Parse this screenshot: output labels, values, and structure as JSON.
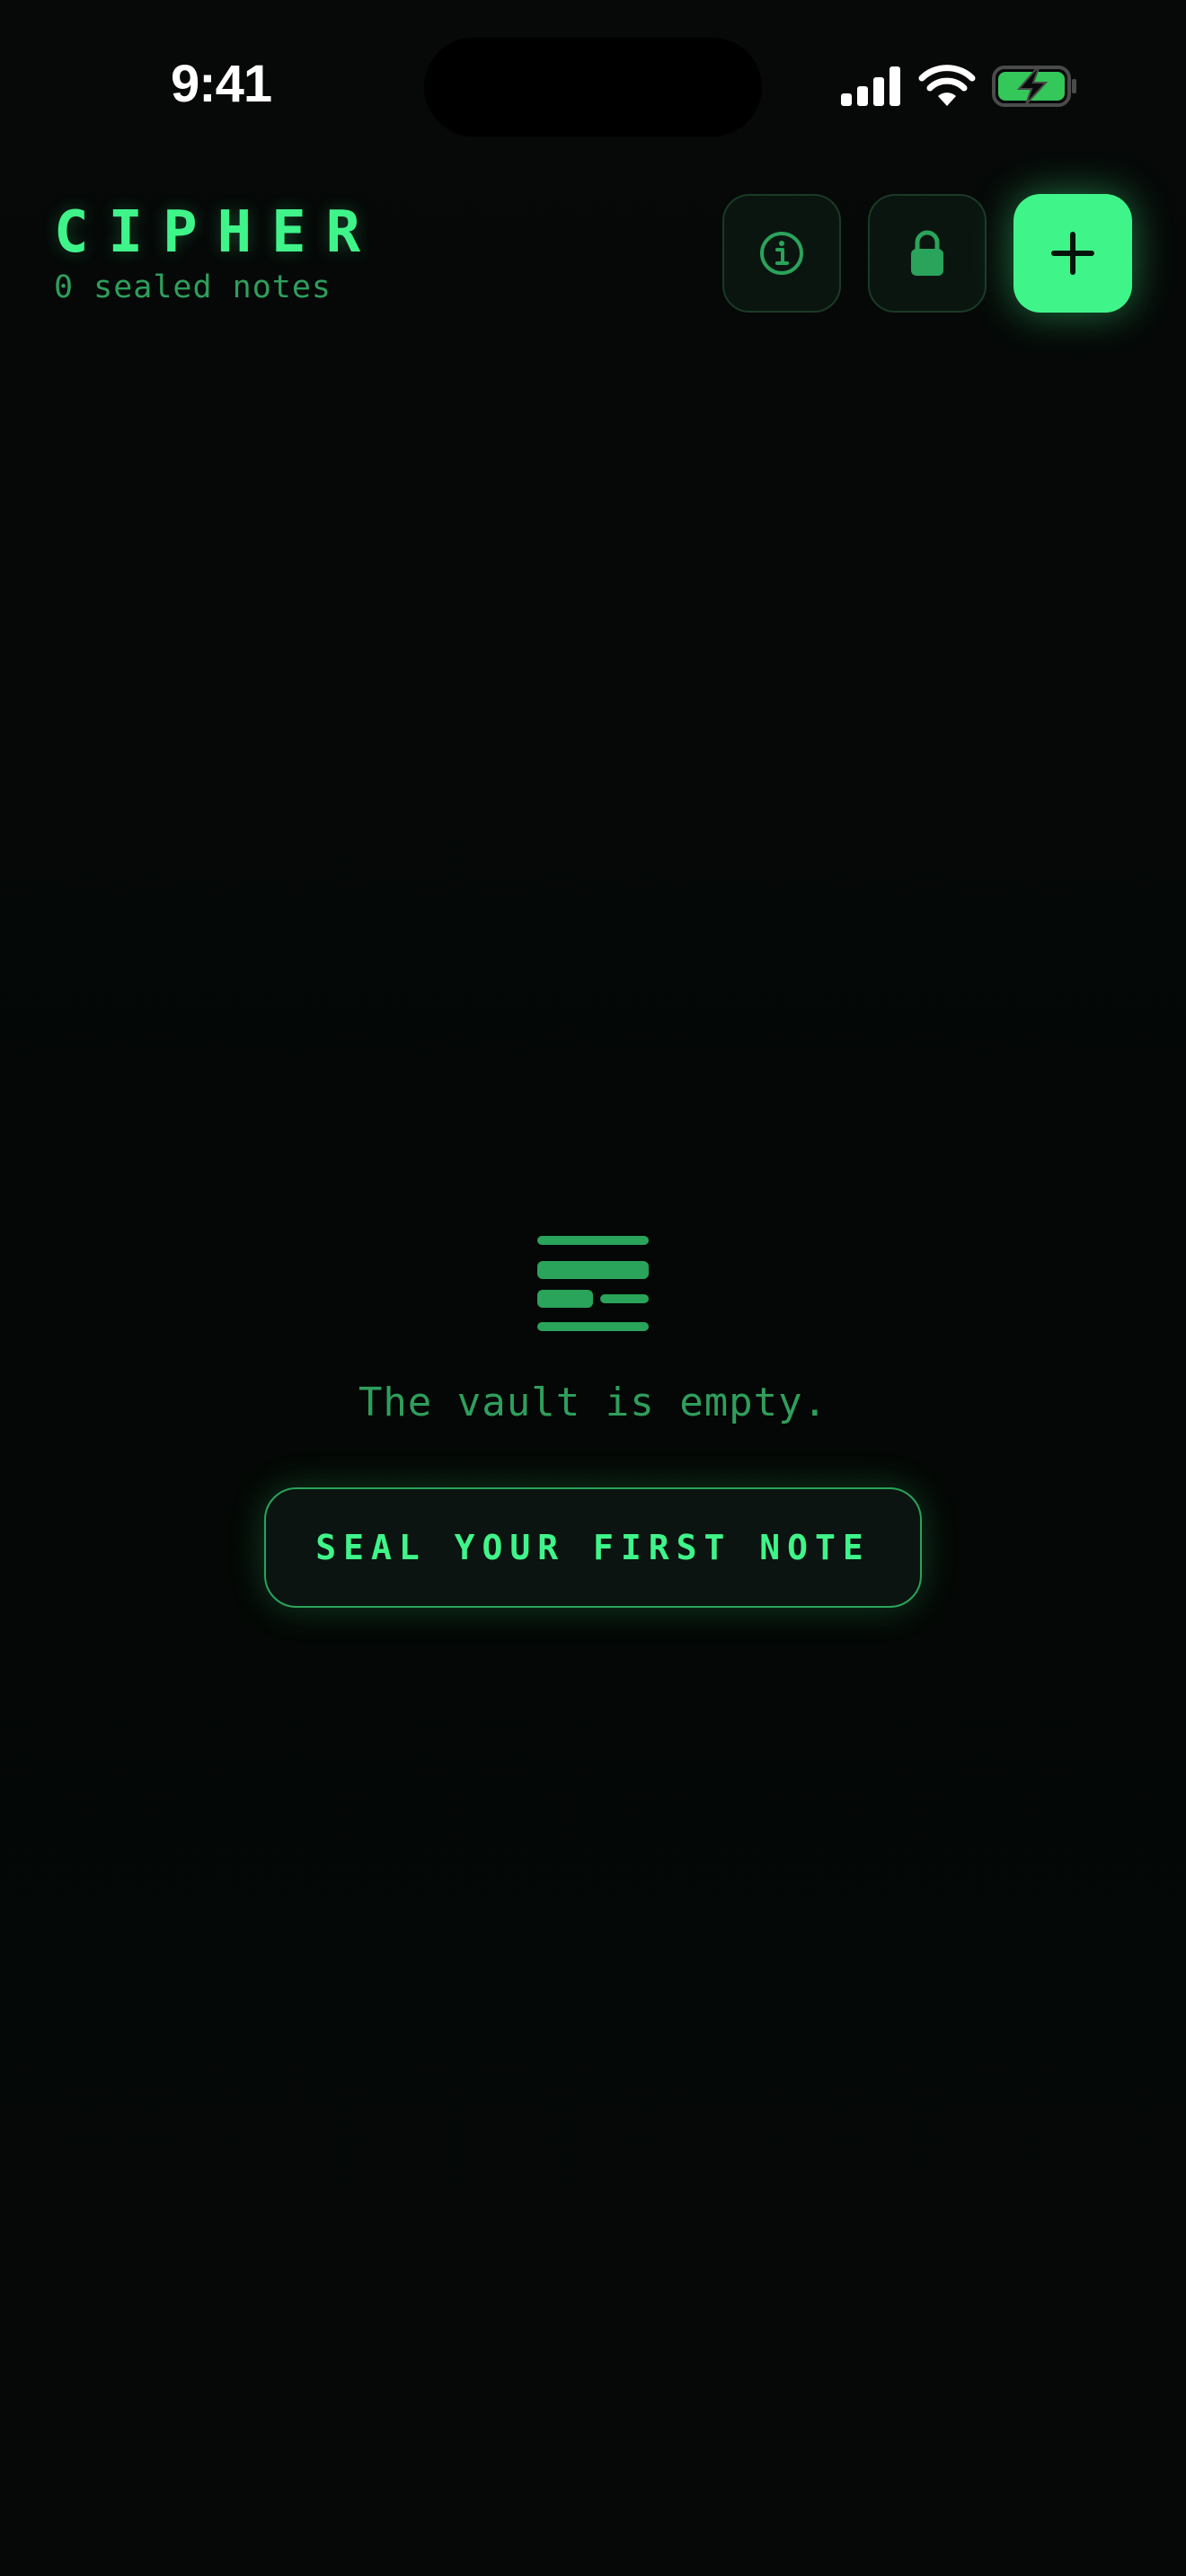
{
  "status_bar": {
    "time": "9:41",
    "icons": [
      "signal-icon",
      "wifi-icon",
      "battery-charging-icon"
    ]
  },
  "header": {
    "title": "CIPHER",
    "subtitle": "0 sealed notes",
    "buttons": {
      "info": "info-icon",
      "lock": "lock-icon",
      "add": "plus-icon"
    }
  },
  "empty_state": {
    "icon": "notes-lines-icon",
    "message": "The vault is empty.",
    "cta_label": "SEAL YOUR FIRST NOTE"
  },
  "colors": {
    "accent": "#3ff58a",
    "accent_dim": "#2f9e5c",
    "background": "#050806",
    "button_surface": "#0b1510",
    "battery_fill": "#34c759"
  }
}
